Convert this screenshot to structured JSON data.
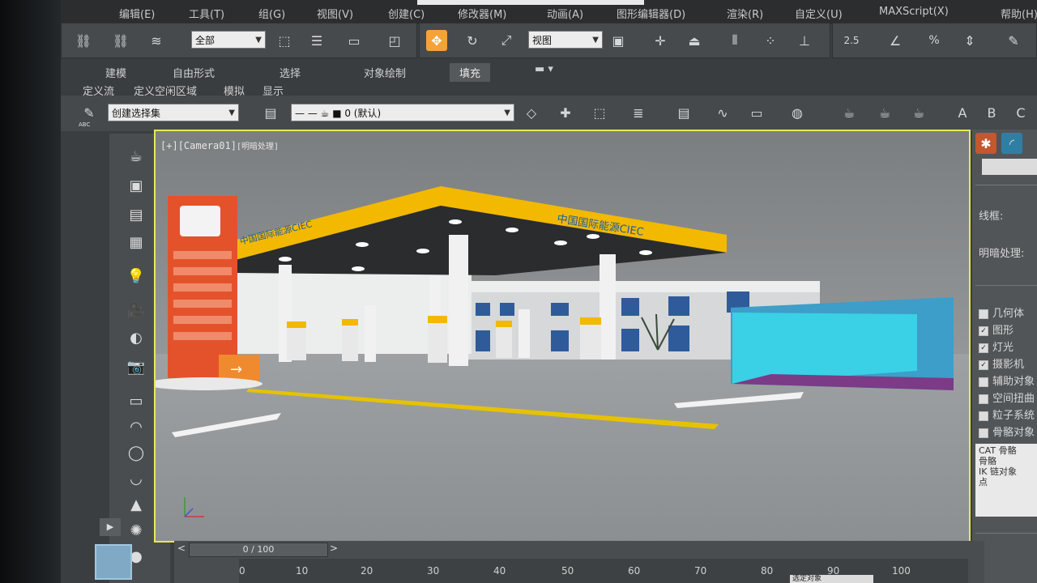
{
  "menu": [
    "编辑(E)",
    "工具(T)",
    "组(G)",
    "视图(V)",
    "创建(C)",
    "修改器(M)",
    "动画(A)",
    "图形编辑器(D)",
    "渲染(R)",
    "自定义(U)",
    "MAXScript(X)",
    "帮助(H)"
  ],
  "toolbar": {
    "selection_filter": "全部",
    "ref_coord": "视图",
    "snap_label": "2.5",
    "percent_label": "%"
  },
  "ribbon": {
    "tabs": [
      "建模",
      "自由形式",
      "选择",
      "对象绘制",
      "填充"
    ],
    "active_tab": "填充",
    "subitems": [
      "定义流",
      "定义空闲区域",
      "模拟",
      "显示"
    ]
  },
  "toolbar2": {
    "selection_set_placeholder": "创建选择集",
    "layer_value": "0 (默认)",
    "abc_label": "ABC"
  },
  "viewport": {
    "label_a": "[+]",
    "label_b": "[Camera01]",
    "label_c": "[明暗处理]",
    "canopy_text": "中国国际能源CIEC",
    "canopy_text_left": "中国国际能源CIEC"
  },
  "command_panel": {
    "name_label": "线框:",
    "shading_label": "明暗处理:",
    "checkboxes": [
      {
        "label": "几何体",
        "checked": false
      },
      {
        "label": "图形",
        "checked": true
      },
      {
        "label": "灯光",
        "checked": true
      },
      {
        "label": "摄影机",
        "checked": true
      },
      {
        "label": "辅助对象",
        "checked": false
      },
      {
        "label": "空间扭曲",
        "checked": false
      },
      {
        "label": "粒子系统",
        "checked": false
      },
      {
        "label": "骨骼对象",
        "checked": false
      }
    ],
    "list_lines": [
      "CAT 骨骼",
      "骨骼",
      "IK 链对象",
      "点"
    ]
  },
  "timeline": {
    "frame": "0 / 100",
    "ticks": [
      "0",
      "10",
      "20",
      "30",
      "40",
      "50",
      "60",
      "70",
      "80",
      "90",
      "100"
    ]
  },
  "status": {
    "selected": "选定对象"
  },
  "colors": {
    "viewport_border": "#e8e85a",
    "active_button": "#f4a23a",
    "canopy": "#f2b900"
  }
}
